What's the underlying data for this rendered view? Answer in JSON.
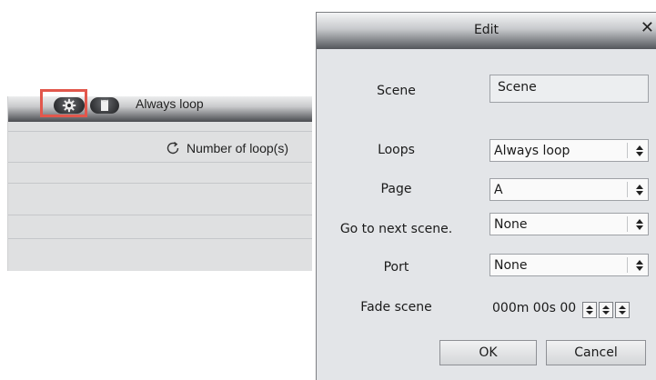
{
  "table": {
    "column_header": "Number of loop(s)",
    "row_loop_value": "Always loop",
    "icons": [
      "refresh-icon",
      "gear-icon",
      "document-icon"
    ]
  },
  "dialog": {
    "title": "Edit",
    "close_glyph": "✕",
    "scene": {
      "label": "Scene",
      "value": "Scene"
    },
    "loops": {
      "label": "Loops",
      "value": "Always loop"
    },
    "page": {
      "label": "Page",
      "value": "A"
    },
    "next_scene": {
      "label": "Go to next scene.",
      "value": "None"
    },
    "port": {
      "label": "Port",
      "value": "None"
    },
    "fade": {
      "label": "Fade scene",
      "value": "000m 00s 00"
    },
    "ok_label": "OK",
    "cancel_label": "Cancel"
  },
  "colors": {
    "highlight": "#e2574c",
    "panel_bg": "#dfe0e1",
    "dialog_bg": "#e3e5e8"
  }
}
